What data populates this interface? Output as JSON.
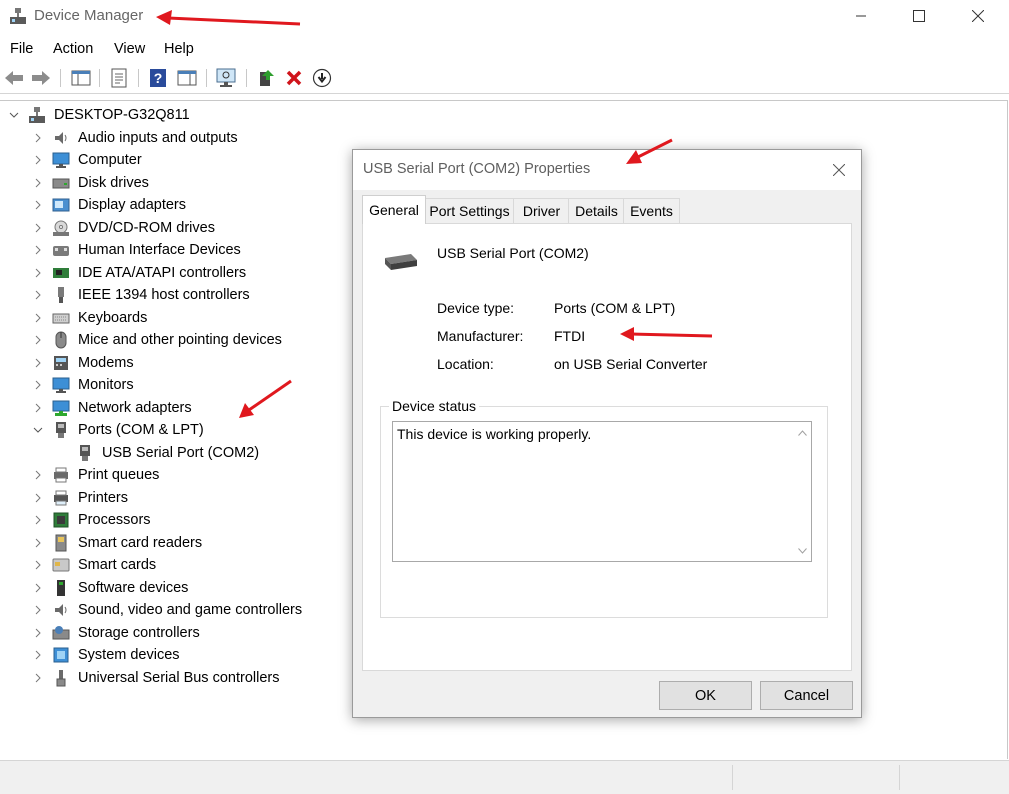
{
  "window": {
    "title": "Device Manager"
  },
  "menu": [
    "File",
    "Action",
    "View",
    "Help"
  ],
  "toolbar": {
    "buttons": [
      "back",
      "forward",
      "show-hide-console-tree",
      "properties",
      "help",
      "action-pane",
      "scan-hardware",
      "update-driver",
      "uninstall",
      "disable"
    ]
  },
  "tree": {
    "root": "DESKTOP-G32Q811",
    "items": [
      {
        "label": "Audio inputs and outputs",
        "icon": "speaker-icon"
      },
      {
        "label": "Computer",
        "icon": "monitor-icon"
      },
      {
        "label": "Disk drives",
        "icon": "disk-drive-icon"
      },
      {
        "label": "Display adapters",
        "icon": "display-adapter-icon"
      },
      {
        "label": "DVD/CD-ROM drives",
        "icon": "dvd-drive-icon"
      },
      {
        "label": "Human Interface Devices",
        "icon": "hid-icon"
      },
      {
        "label": "IDE ATA/ATAPI controllers",
        "icon": "ide-controller-icon"
      },
      {
        "label": "IEEE 1394 host controllers",
        "icon": "firewire-icon"
      },
      {
        "label": "Keyboards",
        "icon": "keyboard-icon"
      },
      {
        "label": "Mice and other pointing devices",
        "icon": "mouse-icon"
      },
      {
        "label": "Modems",
        "icon": "modem-icon"
      },
      {
        "label": "Monitors",
        "icon": "monitor-icon"
      },
      {
        "label": "Network adapters",
        "icon": "network-adapter-icon"
      },
      {
        "label": "Ports (COM & LPT)",
        "icon": "port-icon",
        "expanded": true,
        "children": [
          "USB Serial Port (COM2)"
        ]
      },
      {
        "label": "Print queues",
        "icon": "print-queue-icon"
      },
      {
        "label": "Printers",
        "icon": "printer-icon"
      },
      {
        "label": "Processors",
        "icon": "processor-icon"
      },
      {
        "label": "Smart card readers",
        "icon": "smart-card-reader-icon"
      },
      {
        "label": "Smart cards",
        "icon": "smart-card-icon"
      },
      {
        "label": "Software devices",
        "icon": "software-device-icon"
      },
      {
        "label": "Sound, video and game controllers",
        "icon": "speaker-icon"
      },
      {
        "label": "Storage controllers",
        "icon": "storage-controller-icon"
      },
      {
        "label": "System devices",
        "icon": "system-device-icon"
      },
      {
        "label": "Universal Serial Bus controllers",
        "icon": "usb-icon"
      }
    ]
  },
  "dialog": {
    "title": "USB Serial Port (COM2) Properties",
    "tabs": [
      "General",
      "Port Settings",
      "Driver",
      "Details",
      "Events"
    ],
    "active_tab": "General",
    "device_name": "USB Serial Port (COM2)",
    "properties": [
      {
        "label": "Device type:",
        "value": "Ports (COM & LPT)"
      },
      {
        "label": "Manufacturer:",
        "value": "FTDI"
      },
      {
        "label": "Location:",
        "value": "on USB Serial Converter"
      }
    ],
    "status_group_label": "Device status",
    "status_text": "This device is working properly.",
    "ok_label": "OK",
    "cancel_label": "Cancel"
  },
  "colors": {
    "annotation_arrow": "#e0181e",
    "selection": "#cce8ff",
    "window_bg": "#f0f0f0"
  }
}
